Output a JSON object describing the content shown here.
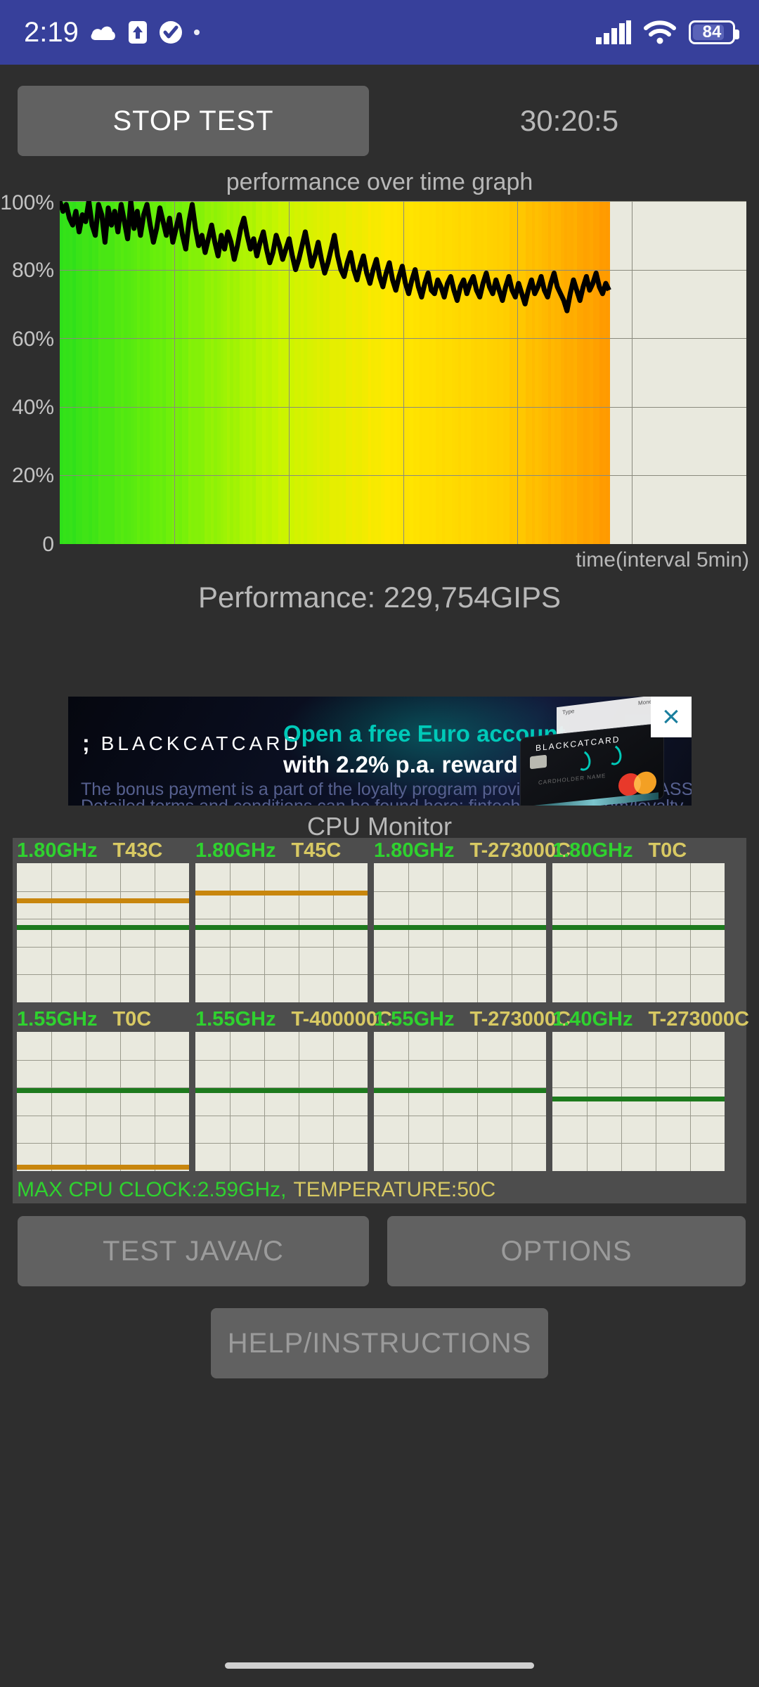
{
  "status_bar": {
    "time": "2:19",
    "battery_percent": "84",
    "icons": [
      "cloud-icon",
      "upload-icon",
      "check-circle-icon",
      "dot-icon",
      "signal-icon",
      "wifi-icon",
      "battery-icon"
    ]
  },
  "controls": {
    "stop_test_label": "STOP TEST",
    "timer": "30:20:5"
  },
  "graph": {
    "title": "performance over time graph",
    "x_axis_label": "time(interval 5min)",
    "y_ticks": [
      "100%",
      "80%",
      "60%",
      "40%",
      "20%",
      "0"
    ],
    "performance_text": "Performance: 229,754GIPS"
  },
  "chart_data": {
    "type": "line",
    "title": "performance over time graph",
    "xlabel": "time(interval 5min)",
    "ylabel": "",
    "ylim": [
      0,
      100
    ],
    "ytick_values": [
      100,
      80,
      60,
      40,
      20,
      0
    ],
    "ytick_labels": [
      "100%",
      "80%",
      "60%",
      "40%",
      "20%",
      "0"
    ],
    "grid": true,
    "legend": "none",
    "x_gridlines": 6,
    "series": [
      {
        "name": "performance",
        "unit": "%",
        "values": [
          100,
          97,
          99,
          95,
          93,
          97,
          91,
          96,
          94,
          100,
          93,
          90,
          99,
          96,
          88,
          98,
          93,
          97,
          91,
          99,
          94,
          89,
          100,
          92,
          97,
          90,
          96,
          99,
          93,
          88,
          92,
          98,
          94,
          90,
          95,
          88,
          92,
          96,
          90,
          86,
          94,
          99,
          92,
          87,
          90,
          85,
          89,
          93,
          88,
          84,
          90,
          86,
          91,
          88,
          83,
          87,
          92,
          95,
          90,
          86,
          89,
          84,
          88,
          91,
          86,
          82,
          85,
          90,
          87,
          83,
          86,
          89,
          84,
          80,
          83,
          87,
          91,
          86,
          81,
          84,
          88,
          83,
          79,
          82,
          86,
          90,
          84,
          80,
          78,
          82,
          85,
          80,
          77,
          81,
          84,
          79,
          76,
          80,
          83,
          78,
          75,
          79,
          82,
          77,
          74,
          78,
          81,
          76,
          73,
          77,
          80,
          75,
          72,
          76,
          79,
          74,
          73,
          77,
          75,
          72,
          76,
          78,
          74,
          71,
          75,
          77,
          73,
          76,
          78,
          74,
          72,
          76,
          79,
          75,
          73,
          77,
          74,
          71,
          75,
          78,
          74,
          72,
          76,
          73,
          70,
          74,
          77,
          73,
          75,
          78,
          74,
          72,
          76,
          79,
          75,
          73,
          71,
          68,
          73,
          77,
          74,
          71,
          75,
          78,
          74,
          76,
          79,
          75,
          73,
          76,
          74
        ]
      }
    ],
    "heat_bands": {
      "description": "background temperature bands colored green to yellow to orange left-to-right",
      "colors": [
        "#2fe01a",
        "#6ff00a",
        "#c9f500",
        "#ffe800",
        "#ffd000",
        "#ff9a00"
      ]
    },
    "data_end_fraction": 0.8
  },
  "ad": {
    "brand": "BLACKCATCARD",
    "logo_mark": ";",
    "headline": "Open a free Euro account",
    "subhead": "with 2.2% p.a. reward",
    "fine_print_1": "The bonus payment is a part of the loyalty program provided by FINTECH ASSETS OU.",
    "fine_print_2": "Detailed terms and conditions can be found here: fintechassetsou.com/loyalty",
    "close_label": "×",
    "card_brand": "BLACKCATCARD",
    "card_name_placeholder": "CARDHOLDER NAME",
    "card_paper_left": "Type",
    "card_paper_right": "Money"
  },
  "cpu_monitor": {
    "title": "CPU Monitor",
    "cores": [
      {
        "clock": "1.80GHz",
        "temp": "T43C",
        "green_line_pct": 46,
        "orange_line_pct": 27
      },
      {
        "clock": "1.80GHz",
        "temp": "T45C",
        "green_line_pct": 46,
        "orange_line_pct": 21
      },
      {
        "clock": "1.80GHz",
        "temp": "T-273000C",
        "green_line_pct": 46,
        "orange_line_pct": null
      },
      {
        "clock": "1.80GHz",
        "temp": "T0C",
        "green_line_pct": 46,
        "orange_line_pct": null
      },
      {
        "clock": "1.55GHz",
        "temp": "T0C",
        "green_line_pct": 42,
        "orange_line_pct": 97
      },
      {
        "clock": "1.55GHz",
        "temp": "T-400000C",
        "green_line_pct": 42,
        "orange_line_pct": null
      },
      {
        "clock": "1.55GHz",
        "temp": "T-273000C",
        "green_line_pct": 42,
        "orange_line_pct": null
      },
      {
        "clock": "1.40GHz",
        "temp": "T-273000C",
        "green_line_pct": 48,
        "orange_line_pct": null
      }
    ],
    "summary_clock": "MAX CPU CLOCK:2.59GHz,",
    "summary_temp": "TEMPERATURE:50C"
  },
  "bottom_buttons": {
    "test_java_c": "TEST JAVA/C",
    "options": "OPTIONS",
    "help": "HELP/INSTRUCTIONS"
  }
}
